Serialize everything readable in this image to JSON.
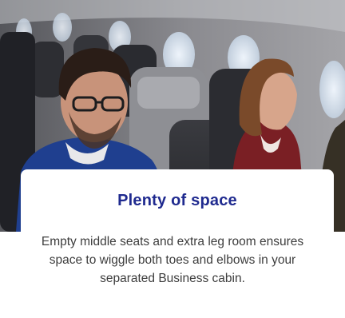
{
  "promo": {
    "title": "Plenty of space",
    "description": "Empty middle seats and extra leg room ensures space to wiggle both toes and elbows in your separated Business cabin."
  },
  "colors": {
    "title": "#1f2a8f",
    "description": "#3d3d3d",
    "panel": "#ffffff"
  },
  "icons": {
    "hero": "airplane-cabin-photo"
  }
}
